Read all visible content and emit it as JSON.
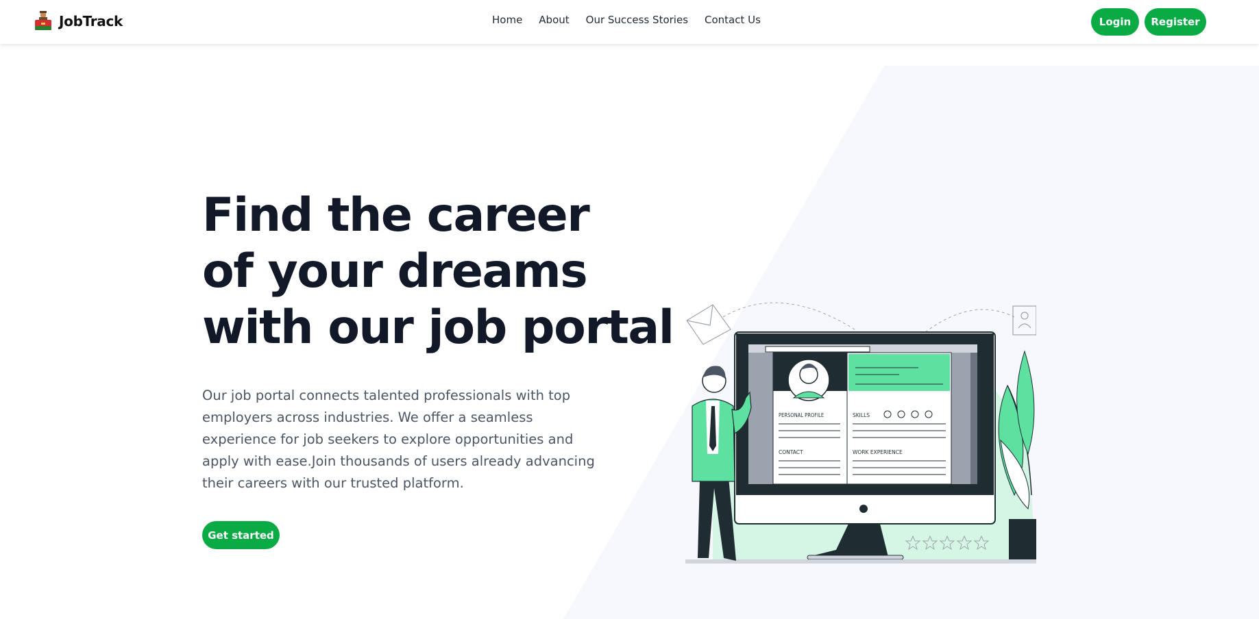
{
  "brand": {
    "name": "JobTrack"
  },
  "nav": {
    "links": [
      "Home",
      "About",
      "Our Success Stories",
      "Contact Us"
    ]
  },
  "auth": {
    "login": "Login",
    "register": "Register"
  },
  "hero": {
    "title_lines": [
      "Find the career",
      "of your dreams",
      "with our job portal"
    ],
    "description": "Our job portal connects talented professionals with top employers across industries. We offer a seamless experience for job seekers to explore opportunities and apply with ease.Join thousands of users already advancing their careers with our trusted platform.",
    "cta": "Get started"
  },
  "illustration": {
    "labels": {
      "personal_profile": "PERSONAL PROFILE",
      "skills": "SKILLS",
      "contact": "CONTACT",
      "work_experience": "WORK EXPERIENCE"
    }
  },
  "colors": {
    "accent": "#0aab45",
    "accent_light": "#5ee1a0",
    "dark": "#1f2d33",
    "text": "#111827",
    "muted": "#4b5563"
  }
}
